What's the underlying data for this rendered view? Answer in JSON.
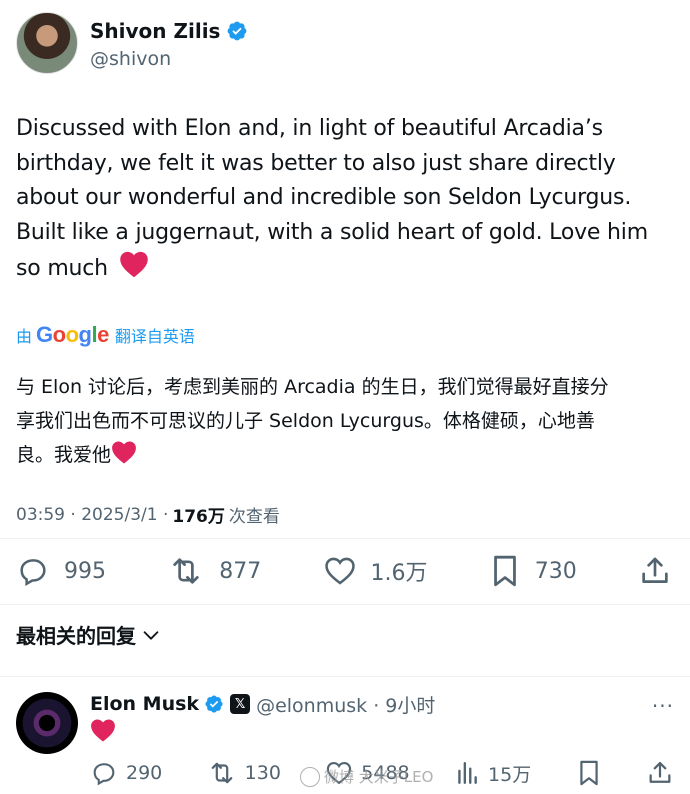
{
  "tweet": {
    "author": {
      "display_name": "Shivon Zilis",
      "handle": "@shivon",
      "verified": true
    },
    "text_lines": [
      "Discussed with Elon and, in light of beautiful Arcadia’s",
      "birthday, we felt it was better to also just share directly",
      "about our wonderful and incredible son Seldon Lycurgus.",
      "Built like a juggernaut, with a solid heart of gold. Love him",
      "so much"
    ],
    "translation": {
      "prefix": "由",
      "brand": [
        "G",
        "o",
        "o",
        "g",
        "l",
        "e"
      ],
      "suffix": "翻译自英语",
      "lines": [
        "与 Elon 讨论后，考虑到美丽的 Arcadia 的生日，我们觉得最好直接分",
        "享我们出色而不可思议的儿子 Seldon Lycurgus。体格健硕，心地善",
        "良。我爱他"
      ]
    },
    "timestamp": "03:59 · 2025/3/1 ·",
    "views_count": "176万",
    "views_label": "次查看",
    "actions": {
      "replies": "995",
      "reposts": "877",
      "likes": "1.6万",
      "bookmarks": "730"
    }
  },
  "sort_label": "最相关的回复",
  "reply": {
    "display_name": "Elon Musk",
    "x_badge": "𝕏",
    "handle_time": "@elonmusk · 9小时",
    "more": "···",
    "actions": {
      "replies": "290",
      "reposts": "130",
      "likes": "5488",
      "views": "15万"
    }
  },
  "watermark": "微博 大米子LEO",
  "colors": {
    "accent": "#1d9bf0",
    "text": "#0f1419",
    "secondary": "#536471",
    "heart": "#e0245e"
  }
}
